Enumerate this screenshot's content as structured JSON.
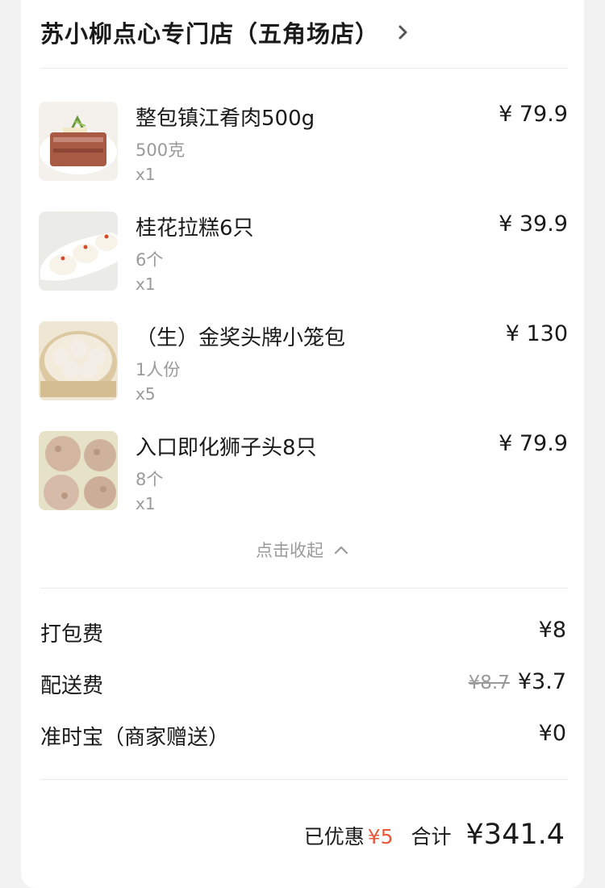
{
  "store": {
    "name": "苏小柳点心专门店（五角场店）"
  },
  "items": [
    {
      "name": "整包镇江肴肉500g",
      "spec": "500克",
      "qty": "x1",
      "price": "¥ 79.9",
      "image": "meat-dish-image"
    },
    {
      "name": "桂花拉糕6只",
      "spec": "6个",
      "qty": "x1",
      "price": "¥ 39.9",
      "image": "buns-plate-image"
    },
    {
      "name": "（生）金奖头牌小笼包",
      "spec": "1人份",
      "qty": "x5",
      "price": "¥ 130",
      "image": "steamer-dumplings-image"
    },
    {
      "name": "入口即化狮子头8只",
      "spec": "8个",
      "qty": "x1",
      "price": "¥ 79.9",
      "image": "meatballs-image"
    }
  ],
  "collapse_label": "点击收起",
  "fees": {
    "packing": {
      "label": "打包费",
      "value": "¥8"
    },
    "delivery": {
      "label": "配送费",
      "original": "¥8.7",
      "value": "¥3.7"
    },
    "ontime": {
      "label": "准时宝（商家赠送）",
      "value": "¥0"
    }
  },
  "summary": {
    "discount_label": "已优惠",
    "discount_value": "¥5",
    "total_label": "合计",
    "total_value": "¥341.4"
  },
  "colors": {
    "accent": "#e8593c",
    "muted": "#9a9a9a",
    "text": "#1a1a1a"
  },
  "icons": {
    "header": "chevron-right-icon",
    "collapse": "chevron-up-icon"
  }
}
